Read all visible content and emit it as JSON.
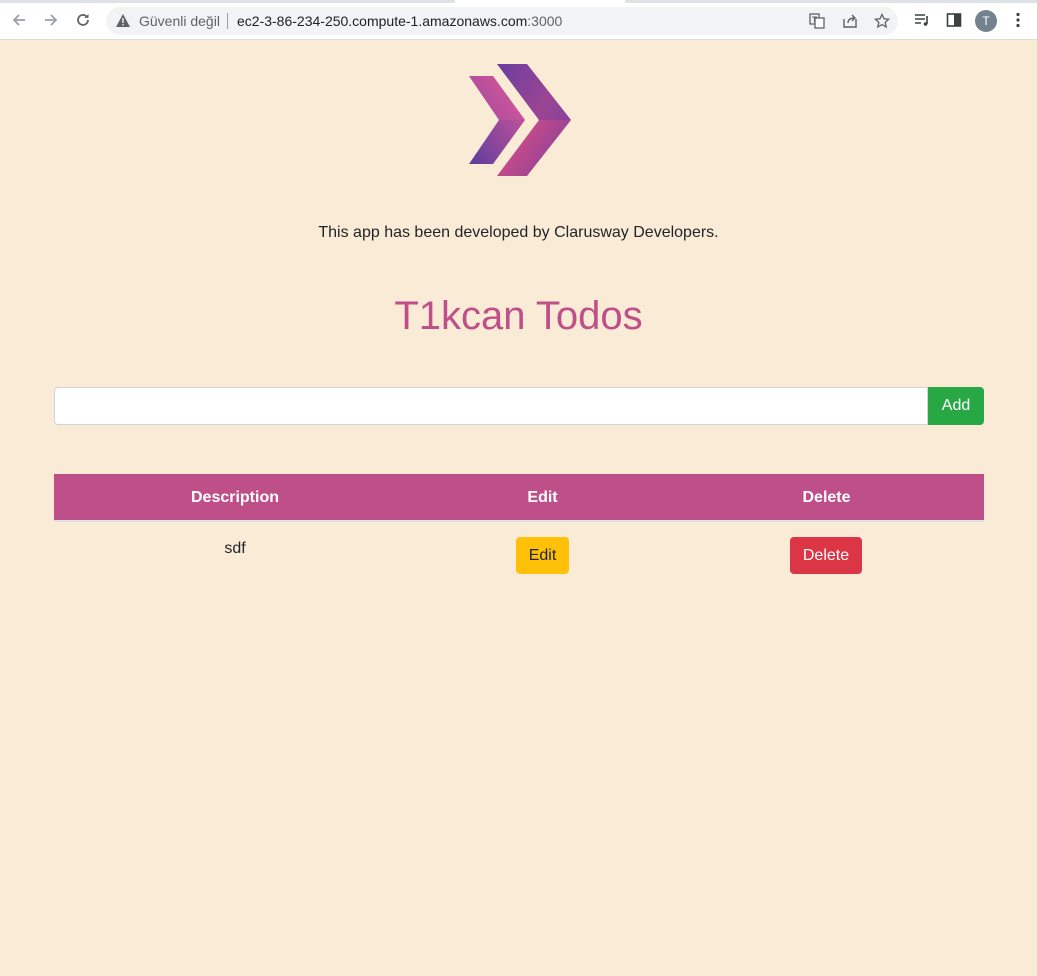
{
  "browser": {
    "security_label": "Güvenli değil",
    "url_host": "ec2-3-86-234-250.compute-1.amazonaws.com",
    "url_port": ":3000",
    "avatar_initial": "T",
    "icons": [
      "back-arrow-icon",
      "forward-arrow-icon",
      "reload-icon",
      "warning-icon",
      "translate-icon",
      "share-icon",
      "star-icon",
      "media-queue-icon",
      "side-panel-icon",
      "more-vert-icon"
    ]
  },
  "page": {
    "credit": "This app has been developed by Clarusway Developers.",
    "title": "T1kcan Todos",
    "input_value": "",
    "add_label": "Add",
    "colors": {
      "background": "#faebd7",
      "accent": "#bf4f88",
      "add": "#28a745",
      "edit": "#ffc107",
      "delete": "#dc3545"
    }
  },
  "table": {
    "headers": {
      "description": "Description",
      "edit": "Edit",
      "delete": "Delete"
    },
    "rows": [
      {
        "description": "sdf",
        "edit_label": "Edit",
        "delete_label": "Delete"
      }
    ]
  }
}
